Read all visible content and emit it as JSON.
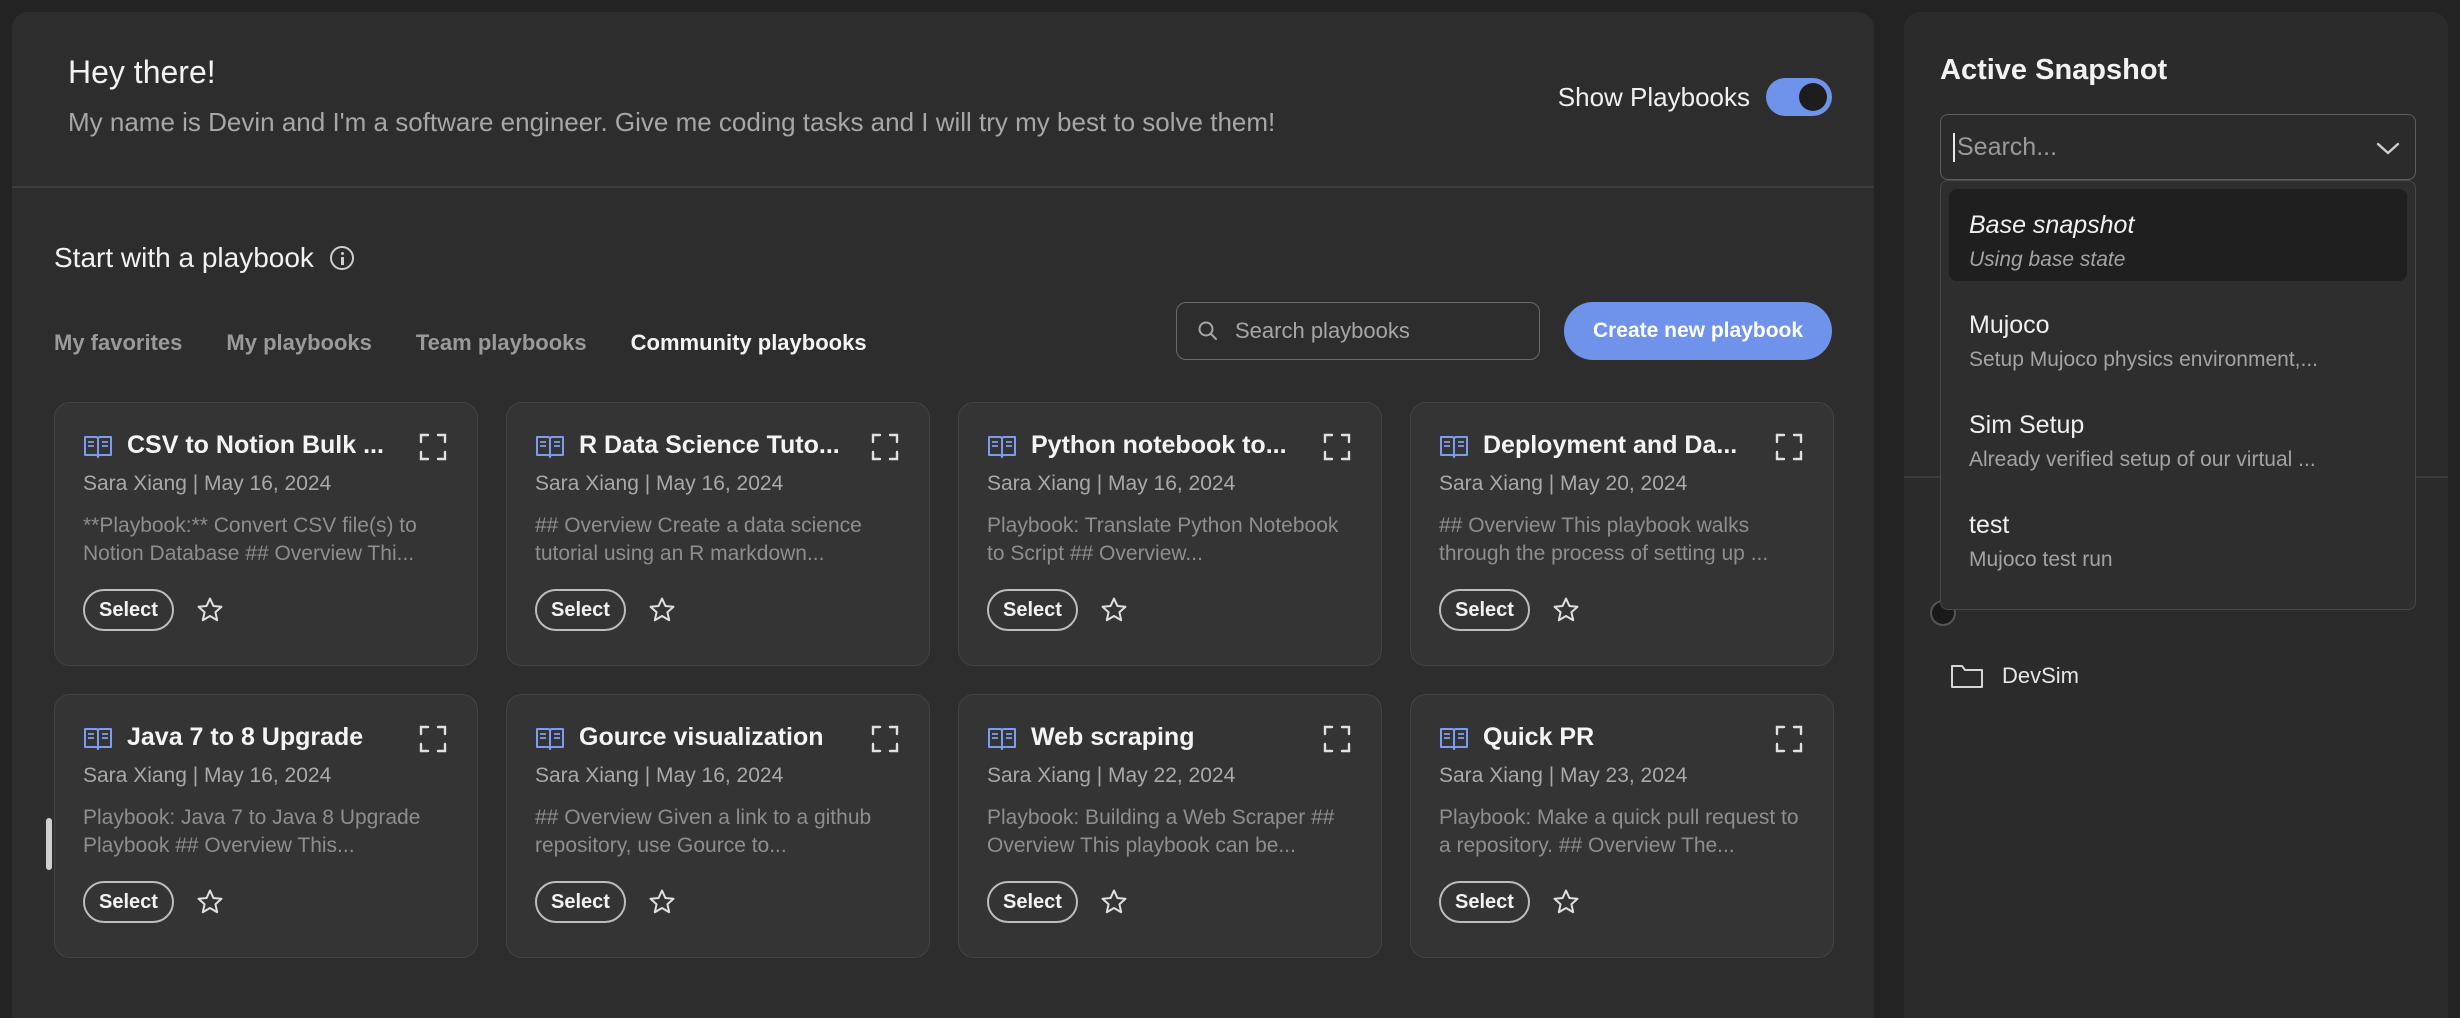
{
  "greeting": {
    "title": "Hey there!",
    "message": "My name is Devin and I'm a software engineer. Give me coding tasks and I will try my best to solve them!"
  },
  "toggle": {
    "label": "Show Playbooks",
    "on": true
  },
  "section": {
    "title": "Start with a playbook"
  },
  "tabs": [
    {
      "label": "My favorites",
      "active": false
    },
    {
      "label": "My playbooks",
      "active": false
    },
    {
      "label": "Team playbooks",
      "active": false
    },
    {
      "label": "Community playbooks",
      "active": true
    }
  ],
  "search": {
    "placeholder": "Search playbooks"
  },
  "create_button": {
    "label": "Create new playbook"
  },
  "colors": {
    "accent": "#6f93ea",
    "book_icon": "#7b9cf0"
  },
  "cards": [
    {
      "title": "CSV to Notion Bulk ...",
      "meta": "Sara Xiang | May 16, 2024",
      "desc": "**Playbook:** Convert CSV file(s) to Notion Database ## Overview Thi...",
      "select": "Select"
    },
    {
      "title": "R Data Science Tuto...",
      "meta": "Sara Xiang | May 16, 2024",
      "desc": "## Overview Create a data science tutorial using an R markdown...",
      "select": "Select"
    },
    {
      "title": "Python notebook to...",
      "meta": "Sara Xiang | May 16, 2024",
      "desc": "Playbook: Translate Python Notebook to Script ## Overview...",
      "select": "Select"
    },
    {
      "title": "Deployment and Da...",
      "meta": "Sara Xiang | May 20, 2024",
      "desc": "## Overview This playbook walks through the process of setting up ...",
      "select": "Select"
    },
    {
      "title": "Java 7 to 8 Upgrade",
      "meta": "Sara Xiang | May 16, 2024",
      "desc": "Playbook: Java 7 to Java 8 Upgrade Playbook ## Overview This...",
      "select": "Select"
    },
    {
      "title": "Gource visualization",
      "meta": "Sara Xiang | May 16, 2024",
      "desc": "## Overview Given a link to a github repository, use Gource to...",
      "select": "Select"
    },
    {
      "title": "Web scraping",
      "meta": "Sara Xiang | May 22, 2024",
      "desc": "Playbook: Building a Web Scraper ## Overview This playbook can be...",
      "select": "Select"
    },
    {
      "title": "Quick PR",
      "meta": "Sara Xiang | May 23, 2024",
      "desc": "Playbook: Make a quick pull request to a repository. ## Overview The...",
      "select": "Select"
    }
  ],
  "snapshot": {
    "title": "Active Snapshot",
    "search_placeholder": "Search...",
    "options": [
      {
        "title": "Base snapshot",
        "subtitle": "Using base state",
        "selected": true
      },
      {
        "title": "Mujoco",
        "subtitle": "Setup Mujoco physics environment,...",
        "selected": false
      },
      {
        "title": "Sim Setup",
        "subtitle": "Already verified setup of our virtual ...",
        "selected": false
      },
      {
        "title": "test",
        "subtitle": "Mujoco test run",
        "selected": false
      }
    ]
  },
  "right_panel": {
    "folder": {
      "label": "DevSim"
    }
  }
}
